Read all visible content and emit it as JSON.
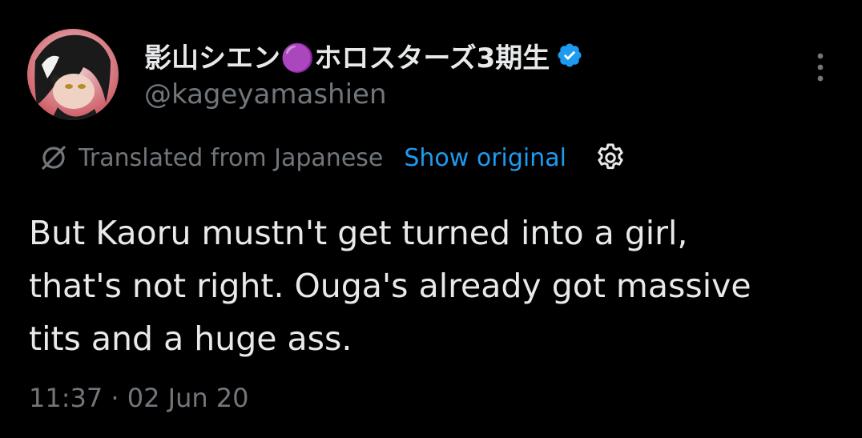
{
  "author": {
    "display_name": "影山シエン🟣ホロスターズ3期生",
    "handle": "@kageyamashien",
    "verified": true
  },
  "translation": {
    "label": "Translated from Japanese",
    "show_original": "Show original"
  },
  "tweet": {
    "text": "But Kaoru mustn't get turned into a girl,\nthat's not right. Ouga's already got massive\ntits and a huge ass."
  },
  "meta": {
    "timestamp": "11:37 · 02 Jun 20"
  },
  "icons": {
    "avatar": "avatar",
    "verified": "verified-badge-icon",
    "more": "more-vertical-icon",
    "translate": "translate-icon",
    "settings": "gear-icon"
  },
  "colors": {
    "background": "#000000",
    "text": "#e7e9ea",
    "secondary": "#71767b",
    "accent": "#1d9bf0"
  }
}
